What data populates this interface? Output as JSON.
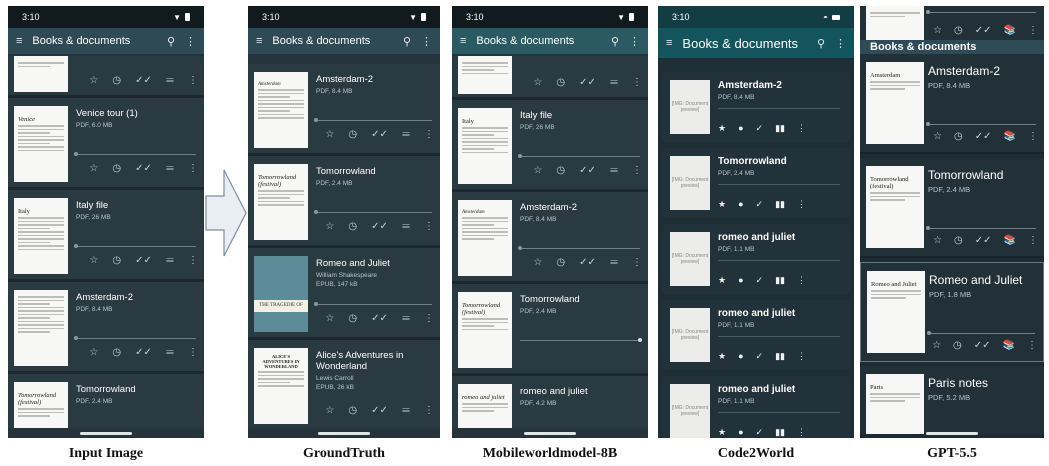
{
  "captions": {
    "input": "Input Image",
    "groundtruth": "GroundTruth",
    "mobileworld": "Mobileworldmodel-8B",
    "code2world": "Code2World",
    "gpt": "GPT-5.5"
  },
  "status": {
    "time": "3:10"
  },
  "app": {
    "title": "Books & documents",
    "menu_icon": "≡",
    "search_icon": "⚲",
    "more_icon": "⋮"
  },
  "actions": {
    "star": "☆",
    "clock": "◷",
    "done": "✓✓",
    "shelf": "𝍢",
    "more": "⋮"
  },
  "input_panel": {
    "items": [
      {
        "name": "",
        "sub": ""
      },
      {
        "name": "Venice tour (1)",
        "sub": "PDF, 6.0 MB",
        "thumb_title": "Venice"
      },
      {
        "name": "Italy file",
        "sub": "PDF, 26 MB",
        "thumb_title": "Italy"
      },
      {
        "name": "Amsterdam-2",
        "sub": "PDF, 8.4 MB",
        "thumb_title": ""
      },
      {
        "name": "Tomorrowland",
        "sub": "PDF, 2.4 MB",
        "thumb_title": "Tomorrowland (festival)"
      }
    ]
  },
  "gt_panel": {
    "items": [
      {
        "name": "Amsterdam-2",
        "sub": "PDF, 8.4 MB",
        "sub2": ""
      },
      {
        "name": "Tomorrowland",
        "sub": "PDF, 2.4 MB",
        "sub2": "",
        "thumb_title": "Tomorrowland (festival)"
      },
      {
        "name": "Romeo and Juliet",
        "sub": "William Shakespeare",
        "sub2": "EPUB, 147 kB",
        "thumb_band": "THE TRAGEDIE OF"
      },
      {
        "name": "Alice's Adventures in Wonderland",
        "sub": "Lewis Carroll",
        "sub2": "EPUB, 26 kB",
        "thumb_title": "ALICE'S ADVENTURES IN WONDERLAND"
      }
    ]
  },
  "mw_panel": {
    "items": [
      {
        "name": "",
        "sub": ""
      },
      {
        "name": "Italy file",
        "sub": "PDF, 26 MB",
        "thumb_title": "Italy"
      },
      {
        "name": "Amsterdam-2",
        "sub": "PDF, 8.4 MB",
        "thumb_title": "Amsterdam"
      },
      {
        "name": "Tomorrowland",
        "sub": "PDF, 2.4 MB",
        "thumb_title": "Tomorrowland (festival)"
      },
      {
        "name": "romeo and juliet",
        "sub": "PDF, 4.2 MB",
        "thumb_title": "romeo and juliet"
      }
    ]
  },
  "c2w_panel": {
    "placeholder": "[IMG: Document preview]",
    "items": [
      {
        "name": "Amsterdam-2",
        "sub": "PDF, 8.4 MB"
      },
      {
        "name": "Tomorrowland",
        "sub": "PDF, 2.4 MB"
      },
      {
        "name": "romeo and juliet",
        "sub": "PDF, 1.1 MB"
      },
      {
        "name": "romeo and juliet",
        "sub": "PDF, 1.1 MB"
      },
      {
        "name": "romeo and juliet",
        "sub": "PDF, 1.1 MB"
      }
    ]
  },
  "gpt_panel": {
    "header": "Books & documents",
    "items": [
      {
        "name": "Amsterdam-2",
        "sub": "PDF, 8.4 MB",
        "thumb_title": "Amsterdam"
      },
      {
        "name": "Tomorrowland",
        "sub": "PDF, 2.4 MB",
        "thumb_title": "Tomorrowland (festival)"
      },
      {
        "name": "Romeo and Juliet",
        "sub": "PDF, 1.8 MB",
        "thumb_title": "Romeo and Juliet"
      },
      {
        "name": "Paris notes",
        "sub": "PDF, 5.2 MB",
        "thumb_title": "Paris"
      }
    ]
  }
}
